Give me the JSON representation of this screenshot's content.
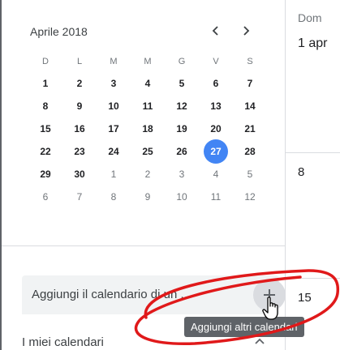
{
  "mini_calendar": {
    "month_title": "Aprile 2018",
    "weekdays": [
      "D",
      "L",
      "M",
      "M",
      "G",
      "V",
      "S"
    ],
    "weeks": [
      [
        "1",
        "2",
        "3",
        "4",
        "5",
        "6",
        "7"
      ],
      [
        "8",
        "9",
        "10",
        "11",
        "12",
        "13",
        "14"
      ],
      [
        "15",
        "16",
        "17",
        "18",
        "19",
        "20",
        "21"
      ],
      [
        "22",
        "23",
        "24",
        "25",
        "26",
        "27",
        "28"
      ],
      [
        "29",
        "30",
        "1",
        "2",
        "3",
        "4",
        "5"
      ],
      [
        "6",
        "7",
        "8",
        "9",
        "10",
        "11",
        "12"
      ]
    ],
    "today": "27",
    "today_color": "#4285f4"
  },
  "add_calendar": {
    "input_text": "Aggiungi il calendario di un ...",
    "tooltip": "Aggiungi altri calendari"
  },
  "my_calendars": {
    "label": "I miei calendari"
  },
  "day_column": {
    "day_name": "Dom",
    "first_date": "1 apr",
    "week2_date": "8",
    "week3_date": "15"
  },
  "icons": {
    "prev": "chevron-left-icon",
    "next": "chevron-right-icon",
    "add": "plus-icon",
    "collapse": "chevron-up-icon",
    "cursor": "hand-pointer-icon"
  }
}
